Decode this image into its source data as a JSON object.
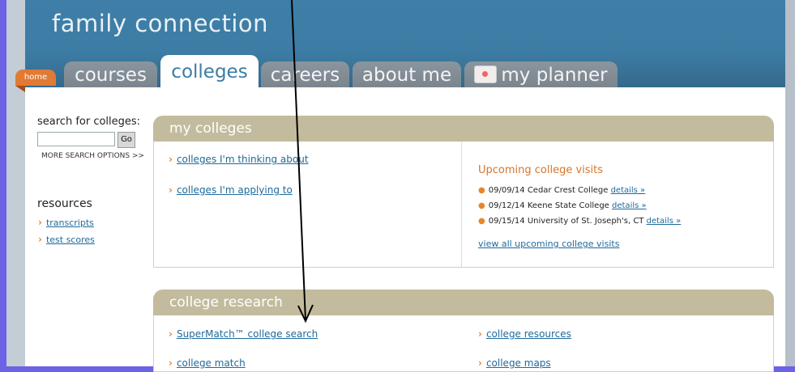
{
  "app_title": "family connection",
  "tabs": {
    "home": "home",
    "courses": "courses",
    "colleges": "colleges",
    "careers": "careers",
    "about_me": "about me",
    "my_planner": "my planner"
  },
  "sidebar": {
    "search_label": "search for colleges:",
    "search_value": "",
    "go_label": "Go",
    "more_search": "MORE SEARCH OPTIONS >>",
    "resources_title": "resources",
    "resources": [
      "transcripts",
      "test scores"
    ]
  },
  "my_colleges": {
    "title": "my colleges",
    "links": [
      "colleges I'm thinking about",
      "colleges I'm applying to"
    ],
    "visits_title": "Upcoming college visits",
    "visits": [
      {
        "text": "09/09/14 Cedar Crest College",
        "link": "details »"
      },
      {
        "text": "09/12/14 Keene State College",
        "link": "details »"
      },
      {
        "text": "09/15/14 University of St. Joseph's, CT",
        "link": "details »"
      }
    ],
    "view_all": "view all upcoming college visits"
  },
  "college_research": {
    "title": "college research",
    "left_links": [
      "SuperMatch™ college search",
      "college match"
    ],
    "right_links": [
      "college resources",
      "college maps"
    ]
  },
  "chevron": "›",
  "bullet": "●",
  "colors": {
    "header": "#3d7ca4",
    "panel_head": "#c3bb9d",
    "link": "#1f6a9b",
    "accent": "#e8862a",
    "page_border": "#6b62e6"
  }
}
